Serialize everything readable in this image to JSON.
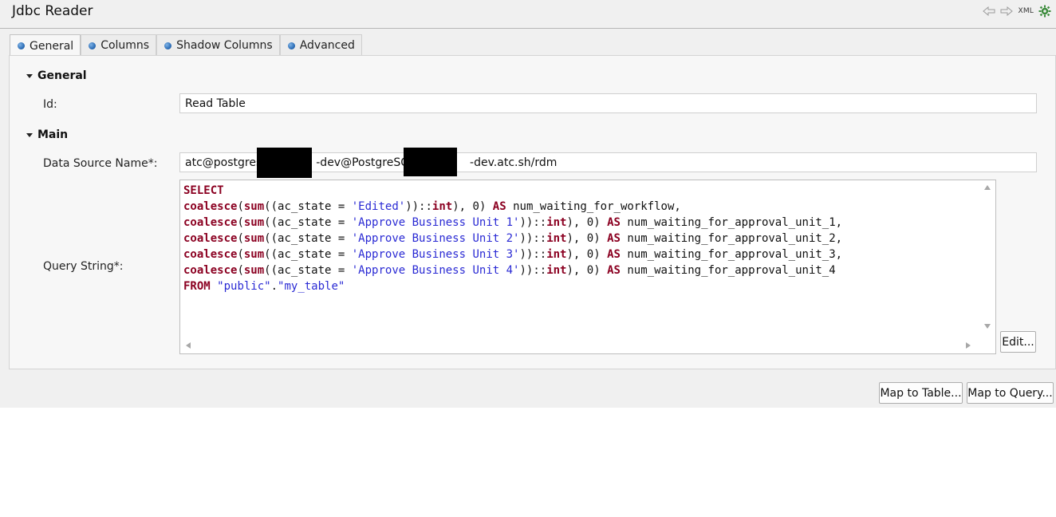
{
  "header": {
    "title": "Jdbc Reader",
    "icons": [
      "back-arrow-icon",
      "forward-arrow-icon",
      "xml-icon",
      "settings-gear-icon"
    ],
    "xml_label": "XML"
  },
  "tabs": [
    {
      "label": "General",
      "active": true
    },
    {
      "label": "Columns",
      "active": false
    },
    {
      "label": "Shadow Columns",
      "active": false
    },
    {
      "label": "Advanced",
      "active": false
    }
  ],
  "sections": {
    "general": "General",
    "main": "Main"
  },
  "fields": {
    "id_label": "Id:",
    "id_value": "Read Table",
    "datasource_label": "Data Source Name*:",
    "datasource_value_part1": "atc@postgres",
    "datasource_value_part2": "-dev@PostgreSQL",
    "datasource_value_part3": "-dev.atc.sh/rdm",
    "query_label": "Query String*:"
  },
  "query_lines": [
    [
      [
        "kw",
        "SELECT"
      ]
    ],
    [
      [
        "kw",
        "coalesce"
      ],
      [
        "p",
        "("
      ],
      [
        "kw",
        "sum"
      ],
      [
        "p",
        "((ac_state = "
      ],
      [
        "str",
        "'Edited'"
      ],
      [
        "p",
        "))::"
      ],
      [
        "kw",
        "int"
      ],
      [
        "p",
        "), "
      ],
      [
        "num",
        "0"
      ],
      [
        "p",
        ") "
      ],
      [
        "kw",
        "AS"
      ],
      [
        "p",
        " num_waiting_for_workflow,"
      ]
    ],
    [
      [
        "kw",
        "coalesce"
      ],
      [
        "p",
        "("
      ],
      [
        "kw",
        "sum"
      ],
      [
        "p",
        "((ac_state = "
      ],
      [
        "str",
        "'Approve Business Unit 1'"
      ],
      [
        "p",
        "))::"
      ],
      [
        "kw",
        "int"
      ],
      [
        "p",
        "), "
      ],
      [
        "num",
        "0"
      ],
      [
        "p",
        ") "
      ],
      [
        "kw",
        "AS"
      ],
      [
        "p",
        " num_waiting_for_approval_unit_1,"
      ]
    ],
    [
      [
        "kw",
        "coalesce"
      ],
      [
        "p",
        "("
      ],
      [
        "kw",
        "sum"
      ],
      [
        "p",
        "((ac_state = "
      ],
      [
        "str",
        "'Approve Business Unit 2'"
      ],
      [
        "p",
        "))::"
      ],
      [
        "kw",
        "int"
      ],
      [
        "p",
        "), "
      ],
      [
        "num",
        "0"
      ],
      [
        "p",
        ") "
      ],
      [
        "kw",
        "AS"
      ],
      [
        "p",
        " num_waiting_for_approval_unit_2,"
      ]
    ],
    [
      [
        "kw",
        "coalesce"
      ],
      [
        "p",
        "("
      ],
      [
        "kw",
        "sum"
      ],
      [
        "p",
        "((ac_state = "
      ],
      [
        "str",
        "'Approve Business Unit 3'"
      ],
      [
        "p",
        "))::"
      ],
      [
        "kw",
        "int"
      ],
      [
        "p",
        "), "
      ],
      [
        "num",
        "0"
      ],
      [
        "p",
        ") "
      ],
      [
        "kw",
        "AS"
      ],
      [
        "p",
        " num_waiting_for_approval_unit_3,"
      ]
    ],
    [
      [
        "kw",
        "coalesce"
      ],
      [
        "p",
        "("
      ],
      [
        "kw",
        "sum"
      ],
      [
        "p",
        "((ac_state = "
      ],
      [
        "str",
        "'Approve Business Unit 4'"
      ],
      [
        "p",
        "))::"
      ],
      [
        "kw",
        "int"
      ],
      [
        "p",
        "), "
      ],
      [
        "num",
        "0"
      ],
      [
        "p",
        ") "
      ],
      [
        "kw",
        "AS"
      ],
      [
        "p",
        " num_waiting_for_approval_unit_4"
      ]
    ],
    [
      [
        "kw",
        "FROM"
      ],
      [
        "p",
        " "
      ],
      [
        "str",
        "\"public\""
      ],
      [
        "p",
        "."
      ],
      [
        "str",
        "\"my_table\""
      ]
    ]
  ],
  "buttons": {
    "edit": "Edit...",
    "map_to_table": "Map to Table...",
    "map_to_query": "Map to Query..."
  },
  "colors": {
    "keyword": "#8b0021",
    "string": "#2a2ad4",
    "tab_bullet": "#2f6fb8"
  }
}
